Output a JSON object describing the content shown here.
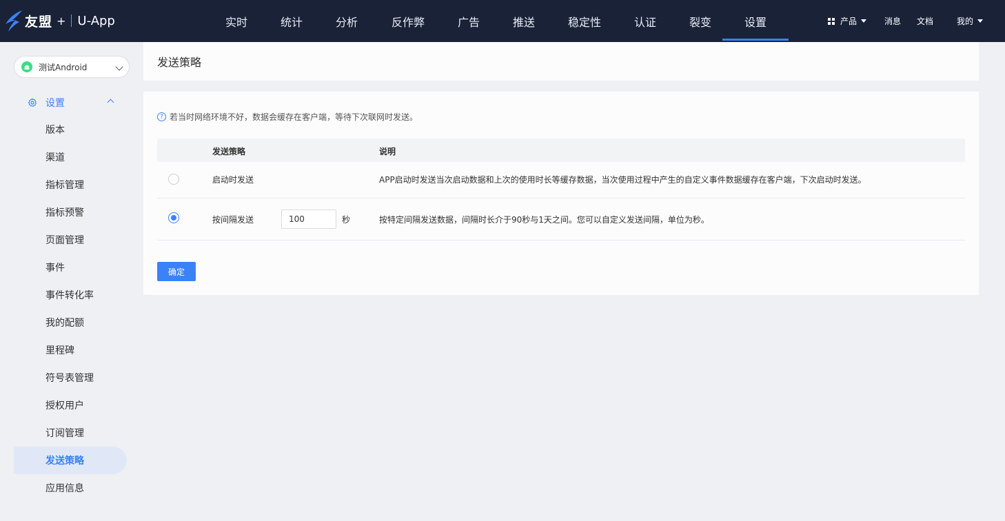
{
  "brand": {
    "name": "友盟",
    "plus": "+",
    "product": "U-App"
  },
  "nav": {
    "items": [
      "实时",
      "统计",
      "分析",
      "反作弊",
      "广告",
      "推送",
      "稳定性",
      "认证",
      "裂变",
      "设置"
    ],
    "active_index": 9
  },
  "nav_right": {
    "product": "产品",
    "messages": "消息",
    "docs": "文档",
    "mine": "我的"
  },
  "sidebar": {
    "app_name": "测试Android",
    "group_label": "设置",
    "items": [
      "版本",
      "渠道",
      "指标管理",
      "指标预警",
      "页面管理",
      "事件",
      "事件转化率",
      "我的配额",
      "里程碑",
      "符号表管理",
      "授权用户",
      "订阅管理",
      "发送策略",
      "应用信息"
    ],
    "active_index": 12
  },
  "page": {
    "title": "发送策略",
    "tip": "若当时网络环境不好，数据会缓存在客户端，等待下次联网时发送。",
    "table": {
      "col_strategy": "发送策略",
      "col_desc": "说明",
      "rows": [
        {
          "label": "启动时发送",
          "desc": "APP启动时发送当次启动数据和上次的使用时长等缓存数据，当次使用过程中产生的自定义事件数据缓存在客户端，下次启动时发送。",
          "selected": false
        },
        {
          "label": "按间隔发送",
          "interval_value": "100",
          "interval_unit": "秒",
          "desc": "按特定间隔发送数据，间隔时长介于90秒与1天之间。您可以自定义发送间隔，单位为秒。",
          "selected": true
        }
      ]
    },
    "confirm_label": "确定"
  }
}
